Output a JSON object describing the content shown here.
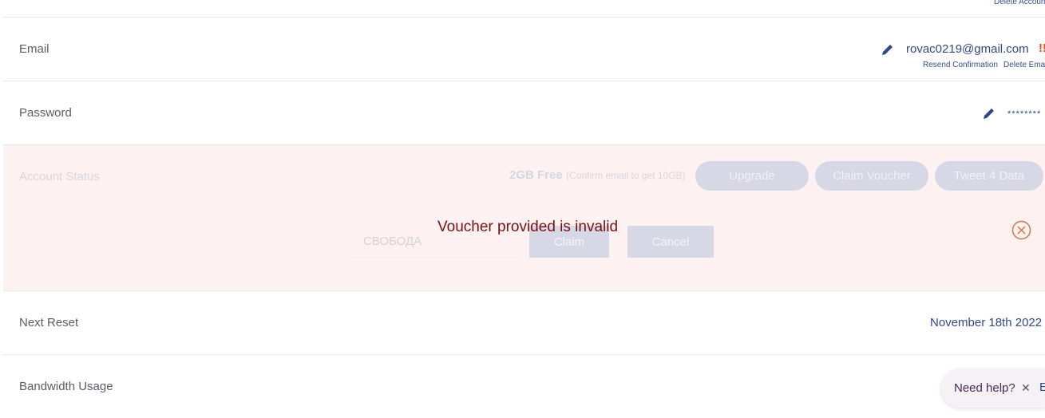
{
  "top": {
    "delete_account": "Delete Account"
  },
  "email": {
    "label": "Email",
    "value": "rovac0219@gmail.com",
    "warning": "!!",
    "resend": "Resend Confirmation",
    "delete": "Delete Email"
  },
  "password": {
    "label": "Password",
    "value": "********"
  },
  "account_status": {
    "label": "Account Status",
    "plan": "2GB Free",
    "plan_note": "(Confirm email to get 10GB)",
    "upgrade": "Upgrade",
    "claim_voucher": "Claim Voucher",
    "tweet": "Tweet 4 Data",
    "voucher_value": "СВОБОДА",
    "claim": "Claim",
    "cancel": "Cancel",
    "error": "Voucher provided is invalid"
  },
  "next_reset": {
    "label": "Next Reset",
    "value": "November 18th 2022"
  },
  "bandwidth": {
    "label": "Bandwidth Usage",
    "value_partial": "E"
  },
  "help": {
    "label": "Need help?",
    "close": "✕"
  },
  "colors": {
    "accent": "#34468a",
    "error": "#7a1010",
    "warning": "#e8442a",
    "close_icon": "#e07040",
    "status_bg": "#fdf1f1"
  }
}
